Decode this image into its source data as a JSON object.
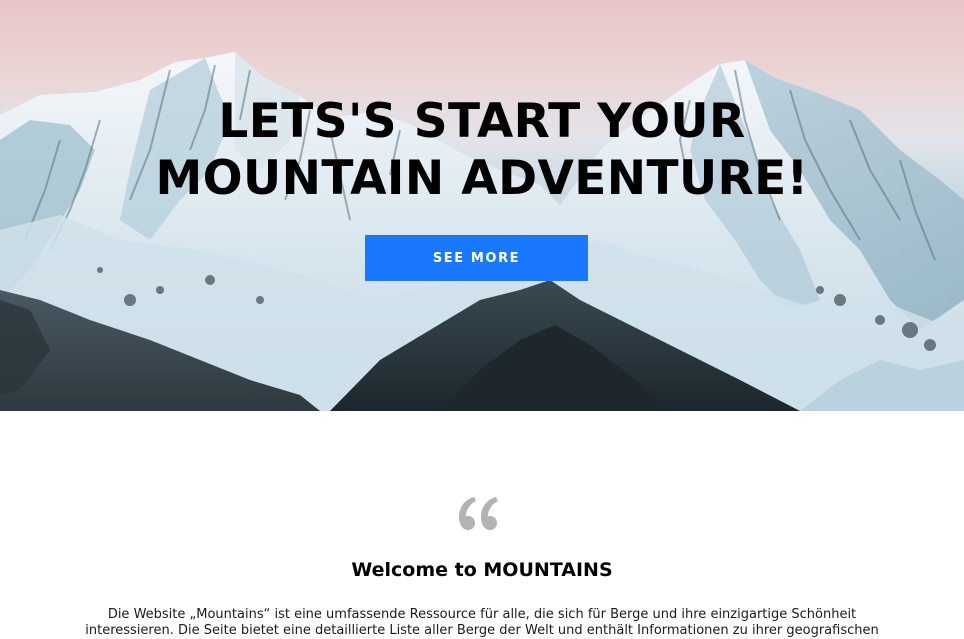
{
  "hero": {
    "title_line1": "LETS'S START YOUR",
    "title_line2": "MOUNTAIN ADVENTURE!",
    "cta_label": "SEE MORE"
  },
  "welcome": {
    "quote_icon": "quote-icon",
    "title": "Welcome to MOUNTAINS",
    "text": "Die Website „Mountains“ ist eine umfassende Ressource für alle, die sich für Berge und ihre einzigartige Schönheit interessieren. Die Seite bietet eine detaillierte Liste aller Berge der Welt und enthält Informationen zu ihrer geografischen"
  },
  "colors": {
    "accent": "#1a78ff",
    "title_text": "#000000",
    "quote_icon": "#b3b3b3"
  }
}
